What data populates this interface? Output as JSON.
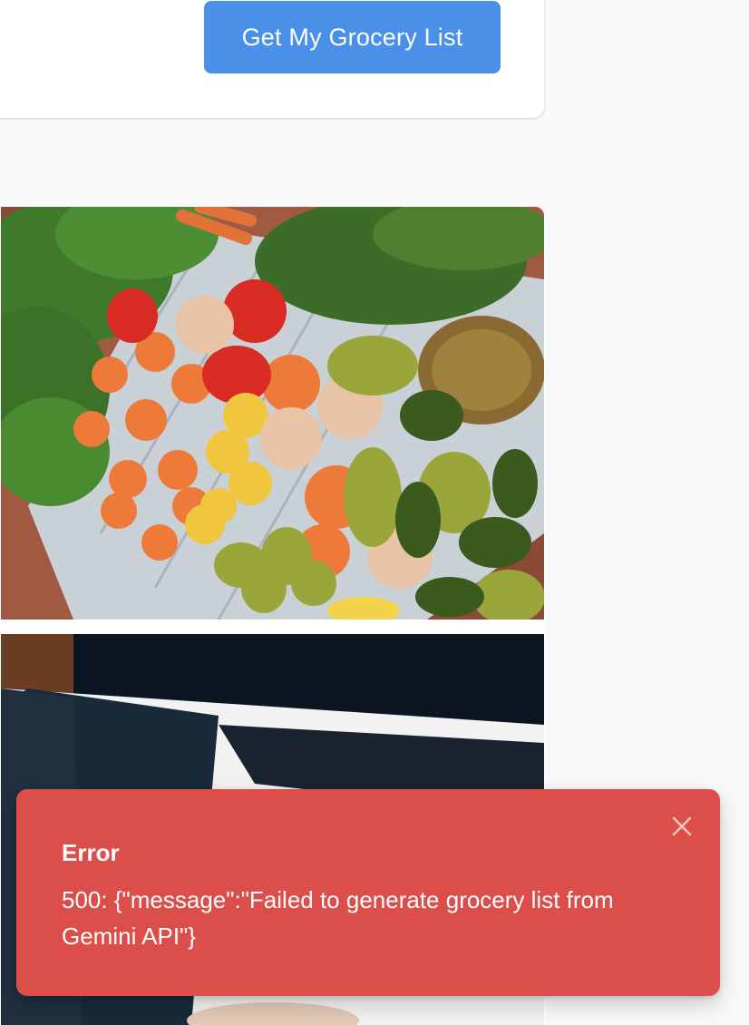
{
  "form": {
    "submit_label": "Get My Grocery List",
    "accent_color": "#4a90e8"
  },
  "gallery": {
    "images": [
      {
        "icon": "produce-photo"
      },
      {
        "icon": "person-photo"
      }
    ]
  },
  "toast": {
    "title": "Error",
    "message": "500: {\"message\":\"Failed to generate grocery list from Gemini API\"}",
    "close_icon": "close-icon",
    "background_color": "#dc4e4a"
  }
}
